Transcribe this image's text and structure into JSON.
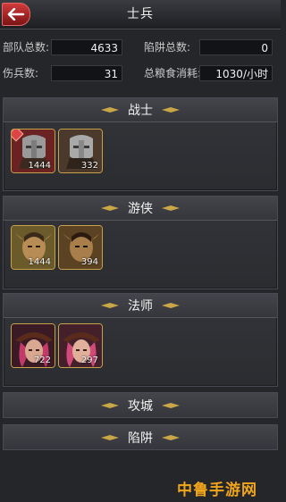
{
  "header": {
    "title": "士兵"
  },
  "stats": {
    "total_troops_label": "部队总数:",
    "total_troops_value": "4633",
    "wounded_label": "伤兵数:",
    "wounded_value": "31",
    "traps_label": "陷阱总数:",
    "traps_value": "0",
    "food_label": "总粮食消耗:",
    "food_value": "1030/小时"
  },
  "sections": [
    {
      "title": "战士",
      "units": [
        {
          "count": "1444"
        },
        {
          "count": "332"
        }
      ]
    },
    {
      "title": "游侠",
      "units": [
        {
          "count": "1444"
        },
        {
          "count": "394"
        }
      ]
    },
    {
      "title": "法师",
      "units": [
        {
          "count": "722"
        },
        {
          "count": "297"
        }
      ]
    },
    {
      "title": "攻城",
      "units": []
    },
    {
      "title": "陷阱",
      "units": []
    }
  ],
  "watermark": {
    "text": "中鲁手游网"
  }
}
